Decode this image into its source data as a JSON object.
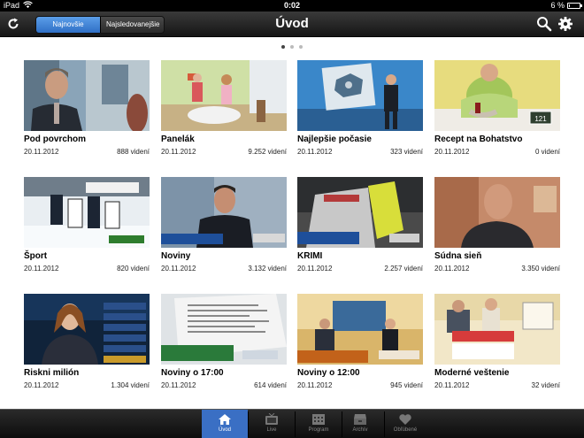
{
  "status": {
    "carrier": "iPad",
    "time": "0:02",
    "battery": "6 %"
  },
  "nav": {
    "title": "Úvod",
    "segments": [
      "Najnovšie",
      "Najsledovanejšie"
    ],
    "refresh_icon": "refresh-icon",
    "search_icon": "search-icon",
    "settings_icon": "gear-icon"
  },
  "pages": {
    "current": 1,
    "total": 3
  },
  "videos": [
    {
      "title": "Pod povrchom",
      "date": "20.11.2012",
      "views": "888 videní"
    },
    {
      "title": "Panelák",
      "date": "20.11.2012",
      "views": "9.252 videní"
    },
    {
      "title": "Najlepšie počasie",
      "date": "20.11.2012",
      "views": "323 videní"
    },
    {
      "title": "Recept na Bohatstvo",
      "date": "20.11.2012",
      "views": "0 videní"
    },
    {
      "title": "Šport",
      "date": "20.11.2012",
      "views": "820 videní"
    },
    {
      "title": "Noviny",
      "date": "20.11.2012",
      "views": "3.132 videní"
    },
    {
      "title": "KRIMI",
      "date": "20.11.2012",
      "views": "2.257 videní"
    },
    {
      "title": "Súdna sieň",
      "date": "20.11.2012",
      "views": "3.350 videní"
    },
    {
      "title": "Riskni milión",
      "date": "20.11.2012",
      "views": "1.304 videní"
    },
    {
      "title": "Noviny o 17:00",
      "date": "20.11.2012",
      "views": "614 videní"
    },
    {
      "title": "Noviny o 12:00",
      "date": "20.11.2012",
      "views": "945 videní"
    },
    {
      "title": "Moderné veštenie",
      "date": "20.11.2012",
      "views": "32 videní"
    }
  ],
  "tabs": [
    {
      "label": "Úvod",
      "icon": "home-icon",
      "active": true
    },
    {
      "label": "Live",
      "icon": "tv-icon",
      "active": false
    },
    {
      "label": "Program",
      "icon": "calendar-icon",
      "active": false
    },
    {
      "label": "Archív",
      "icon": "archive-icon",
      "active": false
    },
    {
      "label": "Obľúbené",
      "icon": "heart-icon",
      "active": false
    }
  ]
}
